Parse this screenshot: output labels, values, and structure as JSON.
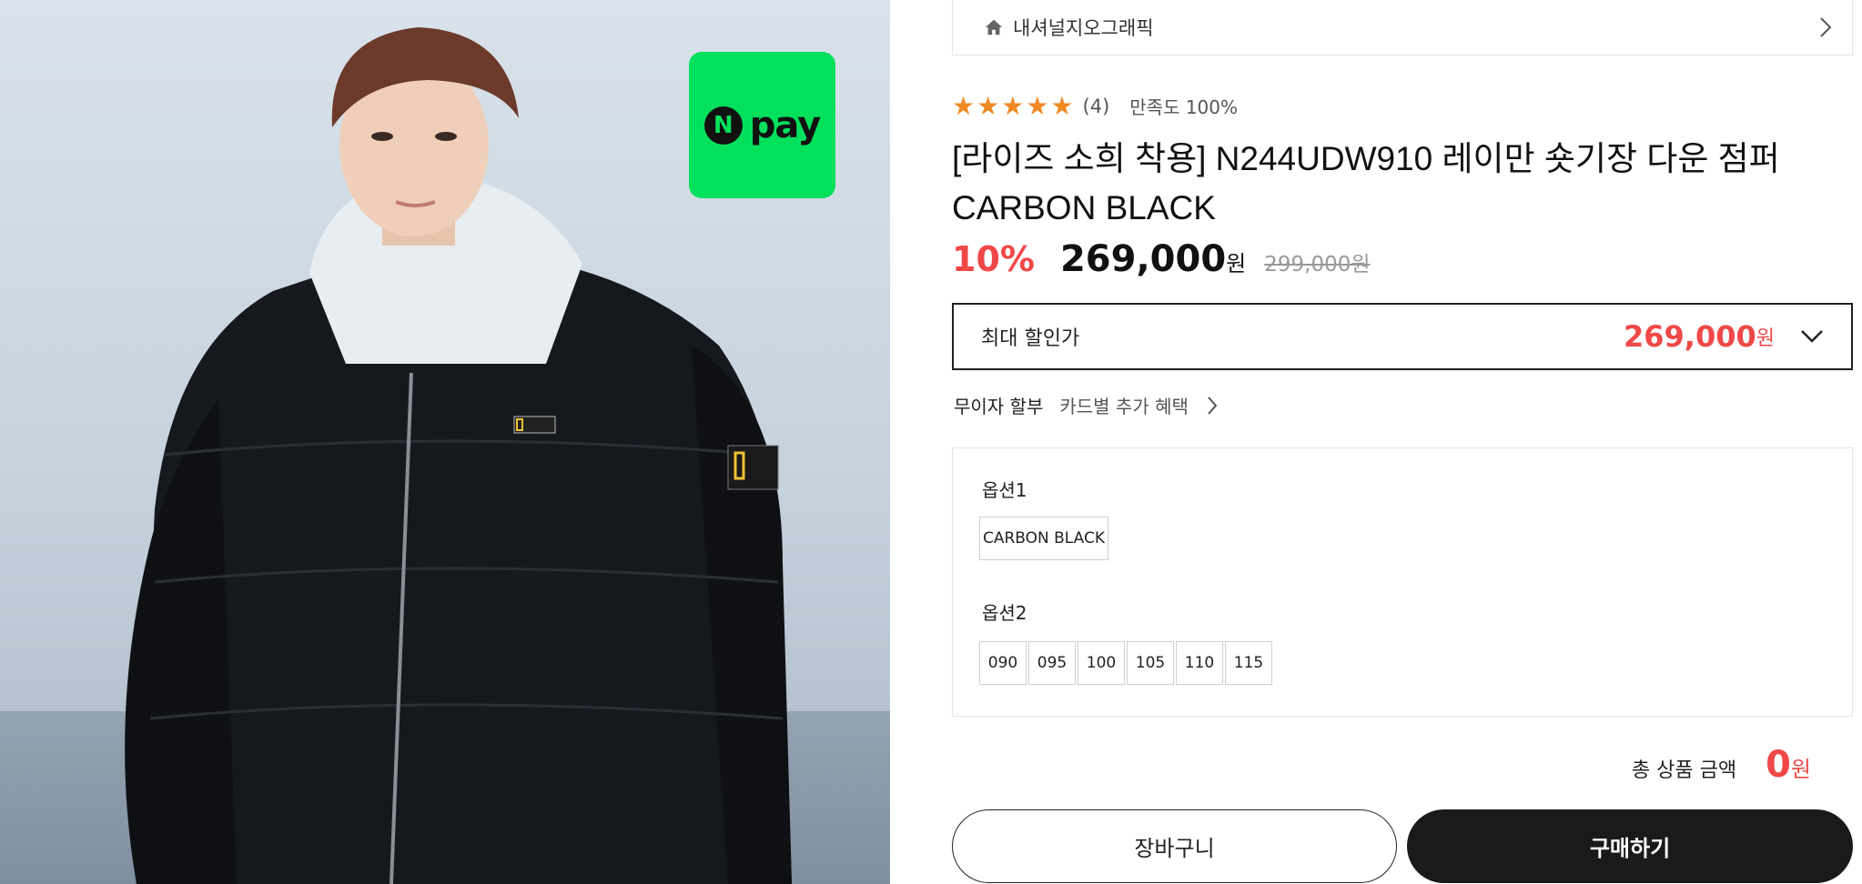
{
  "npay_badge": {
    "label": "pay",
    "n_mark": "N",
    "color": "#03e05c"
  },
  "brand": {
    "name": "내셔널지오그래픽",
    "icon": "home-icon"
  },
  "rating": {
    "stars": "★★★★★",
    "count": "(4)",
    "satisfaction": "만족도 100%",
    "star_color": "#f08a24"
  },
  "product": {
    "title": "[라이즈 소희 착용] N244UDW910 레이만 숏기장 다운 점퍼 CARBON BLACK",
    "discount": "10%",
    "price": "269,000",
    "price_unit": "원",
    "original_price": "299,000원"
  },
  "max_discount": {
    "label": "최대 할인가",
    "price": "269,000",
    "unit": "원"
  },
  "benefits": {
    "installment": "무이자 할부",
    "card_benefit": "카드별 추가 혜택"
  },
  "options": {
    "option1": {
      "label": "옵션1",
      "values": [
        "CARBON BLACK"
      ]
    },
    "option2": {
      "label": "옵션2",
      "values": [
        "090",
        "095",
        "100",
        "105",
        "110",
        "115"
      ]
    }
  },
  "total": {
    "label": "총 상품 금액",
    "amount": "0",
    "unit": "원"
  },
  "actions": {
    "cart": "장바구니",
    "buy": "구매하기"
  },
  "colors": {
    "accent_red": "#f04848",
    "dark": "#1a1a1a"
  }
}
